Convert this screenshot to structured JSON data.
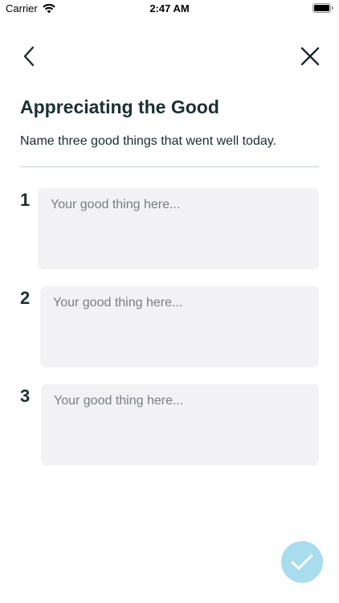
{
  "status_bar": {
    "carrier": "Carrier",
    "time": "2:47 AM"
  },
  "nav": {
    "back_icon": "chevron-left-icon",
    "close_icon": "close-icon"
  },
  "header": {
    "title": "Appreciating the Good",
    "subtitle": "Name three good things that went well today."
  },
  "entries": [
    {
      "number": "1",
      "value": "",
      "placeholder": "Your good thing here..."
    },
    {
      "number": "2",
      "value": "",
      "placeholder": "Your good thing here..."
    },
    {
      "number": "3",
      "value": "",
      "placeholder": "Your good thing here..."
    }
  ],
  "submit": {
    "icon": "checkmark-icon",
    "color": "#a9dcec"
  }
}
